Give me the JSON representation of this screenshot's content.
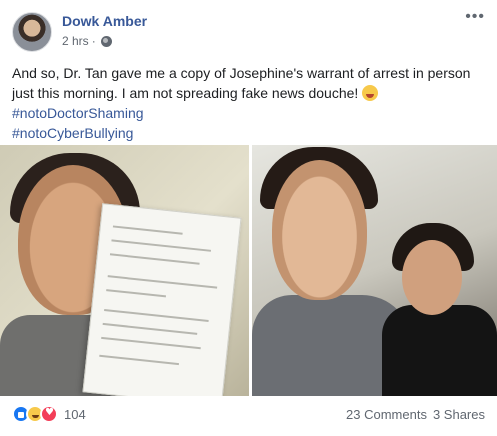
{
  "post": {
    "author": "Dowk Amber",
    "time": "2 hrs",
    "time_separator": "·",
    "privacy_icon": "globe-icon",
    "more_icon": "ellipsis-icon",
    "text": "And so, Dr. Tan gave me a copy of Josephine's warrant of arrest in person just this morning. I am not spreading fake news douche!",
    "hashtags": [
      "#notoDoctorShaming",
      "#notoCyberBullying"
    ],
    "emoji": "grinning-tongue-emoji"
  },
  "photos": {
    "left": "photo-man-holding-warrant-document",
    "right": "photo-selfie-man-with-woman"
  },
  "footer": {
    "reaction_icons": [
      "like-icon",
      "haha-icon",
      "love-icon"
    ],
    "reaction_count": "104",
    "comments": "23 Comments",
    "shares": "3 Shares"
  },
  "colors": {
    "link": "#385898",
    "text": "#1c1e21",
    "secondary": "#606770",
    "like": "#1877f2",
    "haha": "#f7c94b",
    "love": "#f33e58"
  }
}
